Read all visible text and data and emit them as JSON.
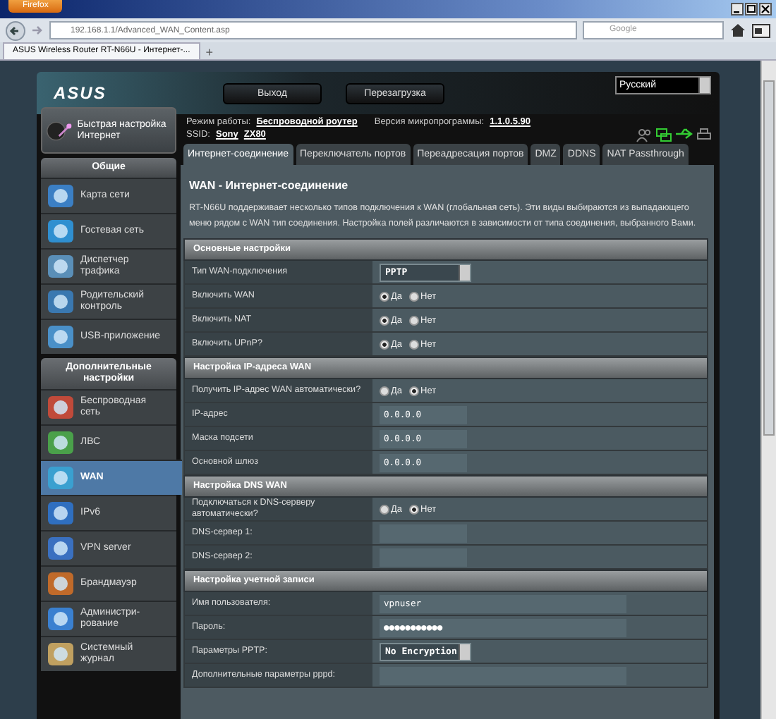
{
  "browser": {
    "app_button": "Firefox",
    "address": "192.168.1.1/Advanced_WAN_Content.asp",
    "search_placeholder": "Google",
    "tabs": [
      {
        "label": "ASUS Wireless Router RT-N66U - Интернет-...",
        "selected": true
      }
    ],
    "new_tab": "+"
  },
  "header": {
    "logo": "ASUS",
    "buttons": [
      "Выход",
      "Перезагрузка"
    ],
    "language": "Русский",
    "mode_label": "Режим работы:",
    "mode": "Беспроводной роутер",
    "firmware_label": "Версия микропрограммы:",
    "firmware": "1.1.0.5.90",
    "ssid_label": "SSID:",
    "ssids": [
      "Sony",
      "ZX80"
    ]
  },
  "sidebar": {
    "quick_setup": "Быстрая настройка Интернет",
    "groups": [
      {
        "title": "Общие",
        "items": [
          {
            "label": "Карта сети",
            "selected": false
          },
          {
            "label": "Гостевая сеть",
            "selected": false
          },
          {
            "label": "Диспетчер трафика",
            "selected": false
          },
          {
            "label": "Родительский контроль",
            "selected": false
          },
          {
            "label": "USB-приложение",
            "selected": false
          }
        ]
      },
      {
        "title": "Дополнительные настройки",
        "items": [
          {
            "label": "Беспроводная сеть",
            "selected": false
          },
          {
            "label": "ЛВС",
            "selected": false
          },
          {
            "label": "WAN",
            "selected": true
          },
          {
            "label": "IPv6",
            "selected": false
          },
          {
            "label": "VPN server",
            "selected": false
          },
          {
            "label": "Брандмауэр",
            "selected": false
          },
          {
            "label": "Администри-рование",
            "selected": false
          },
          {
            "label": "Системный журнал",
            "selected": false
          }
        ]
      }
    ]
  },
  "tabs": [
    {
      "label": "Интернет-соединение",
      "selected": true
    },
    {
      "label": "Переключатель портов",
      "selected": false
    },
    {
      "label": "Переадресация портов",
      "selected": false
    },
    {
      "label": "DMZ",
      "selected": false
    },
    {
      "label": "DDNS",
      "selected": false
    },
    {
      "label": "NAT Passthrough",
      "selected": false
    }
  ],
  "page": {
    "title": "WAN - Интернет-соединение",
    "description": "RT-N66U поддерживает несколько типов подключения к WAN (глобальная сеть). Эти виды выбираются из выпадающего меню рядом с WAN тип соединения. Настройка полей различаются в зависимости от типа соединения, выбранного Вами."
  },
  "sections": [
    {
      "title": "Основные настройки",
      "rows": [
        {
          "label": "Тип WAN-подключения",
          "kind": "select",
          "value": "PPTP"
        },
        {
          "label": "Включить WAN",
          "kind": "radio",
          "options": [
            {
              "label": "Да",
              "selected": true
            },
            {
              "label": "Нет",
              "selected": false
            }
          ]
        },
        {
          "label": "Включить NAT",
          "kind": "radio",
          "options": [
            {
              "label": "Да",
              "selected": true
            },
            {
              "label": "Нет",
              "selected": false
            }
          ]
        },
        {
          "label": "Включить UPnP?",
          "kind": "radio",
          "options": [
            {
              "label": "Да",
              "selected": true
            },
            {
              "label": "Нет",
              "selected": false
            }
          ]
        }
      ]
    },
    {
      "title": "Настройка IP-адреса WAN",
      "rows": [
        {
          "label": "Получить IP-адрес WAN автоматически?",
          "kind": "radio",
          "options": [
            {
              "label": "Да",
              "selected": false
            },
            {
              "label": "Нет",
              "selected": true
            }
          ]
        },
        {
          "label": "IP-адрес",
          "kind": "short-field",
          "value": "0.0.0.0"
        },
        {
          "label": "Маска подсети",
          "kind": "short-field",
          "value": "0.0.0.0"
        },
        {
          "label": "Основной шлюз",
          "kind": "short-field",
          "value": "0.0.0.0"
        }
      ]
    },
    {
      "title": "Настройка DNS WAN",
      "rows": [
        {
          "label": "Подключаться к DNS-серверу автоматически?",
          "kind": "radio",
          "options": [
            {
              "label": "Да",
              "selected": false
            },
            {
              "label": "Нет",
              "selected": true
            }
          ]
        },
        {
          "label": "DNS-сервер 1:",
          "kind": "short-field"
        },
        {
          "label": "DNS-сервер 2:",
          "kind": "short-field"
        }
      ]
    },
    {
      "title": "Настройка учетной записи",
      "rows": [
        {
          "label": "Имя пользователя:",
          "kind": "long-field",
          "value": "vpnuser"
        },
        {
          "label": "Пароль:",
          "kind": "long-field",
          "value": "●●●●●●●●●●●"
        },
        {
          "label": "Параметры PPTP:",
          "kind": "select",
          "value": "No Encryption"
        },
        {
          "label": "Дополнительные параметры pppd:",
          "kind": "long-field"
        }
      ]
    }
  ]
}
